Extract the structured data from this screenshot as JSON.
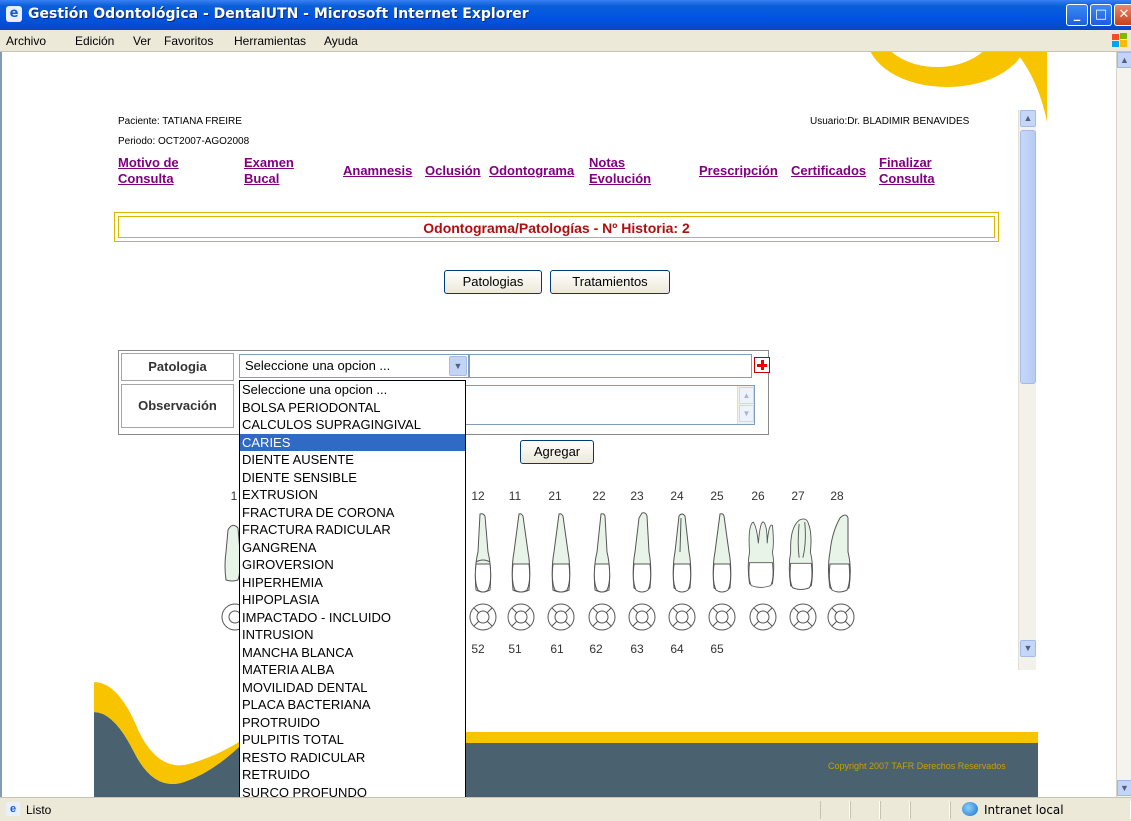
{
  "window": {
    "title": "Gestión Odontológica - DentalUTN - Microsoft Internet Explorer",
    "controls": [
      "_",
      "□",
      "✕"
    ]
  },
  "menu": [
    "Archivo",
    "Edición",
    "Ver",
    "Favoritos",
    "Herramientas",
    "Ayuda"
  ],
  "session": {
    "paciente": "Paciente: TATIANA FREIRE",
    "periodo": "Periodo: OCT2007-AGO2008",
    "usuario": "Usuario:Dr. BLADIMIR BENAVIDES"
  },
  "nav": [
    {
      "line1": "Motivo de",
      "line2": "Consulta"
    },
    {
      "line1": "Examen",
      "line2": "Bucal"
    },
    {
      "line1": "Anamnesis",
      "line2": ""
    },
    {
      "line1": "Oclusión",
      "line2": ""
    },
    {
      "line1": "Odontograma",
      "line2": ""
    },
    {
      "line1": "Notas",
      "line2": "Evolución"
    },
    {
      "line1": "Prescripción",
      "line2": ""
    },
    {
      "line1": "Certificados",
      "line2": ""
    },
    {
      "line1": "Finalizar",
      "line2": "Consulta"
    }
  ],
  "header_title": "Odontograma/Patologías - Nº Historia: 2",
  "buttons": {
    "patologias": "Patologias",
    "tratamientos": "Tratamientos",
    "agregar": "Agregar"
  },
  "form": {
    "patologia_label": "Patologia",
    "observacion_label": "Observación",
    "select_value": "Seleccione una opcion ..."
  },
  "dropdown_options": [
    "Seleccione una opcion ...",
    "BOLSA PERIODONTAL",
    "CALCULOS SUPRAGINGIVAL",
    "CARIES",
    "DIENTE AUSENTE",
    "DIENTE SENSIBLE",
    "EXTRUSION",
    "FRACTURA DE CORONA",
    "FRACTURA RADICULAR",
    "GANGRENA",
    "GIROVERSION",
    "HIPERHEMIA",
    "HIPOPLASIA",
    "IMPACTADO - INCLUIDO",
    "INTRUSION",
    "MANCHA BLANCA",
    "MATERIA ALBA",
    "MOVILIDAD DENTAL",
    "PLACA BACTERIANA",
    "PROTRUIDO",
    "PULPITIS TOTAL",
    "RESTO RADICULAR",
    "RETRUIDO",
    "SURCO PROFUNDO"
  ],
  "dropdown_selected": "CARIES",
  "teeth_upper": [
    "1",
    "12",
    "11",
    "21",
    "22",
    "23",
    "24",
    "25",
    "26",
    "27",
    "28"
  ],
  "teeth_lower": [
    "52",
    "51",
    "61",
    "62",
    "63",
    "64",
    "65"
  ],
  "copyright": "Copyright 2007 TAFR Derechos Reservados",
  "status": {
    "left": "Listo",
    "zone": "Intranet local"
  }
}
